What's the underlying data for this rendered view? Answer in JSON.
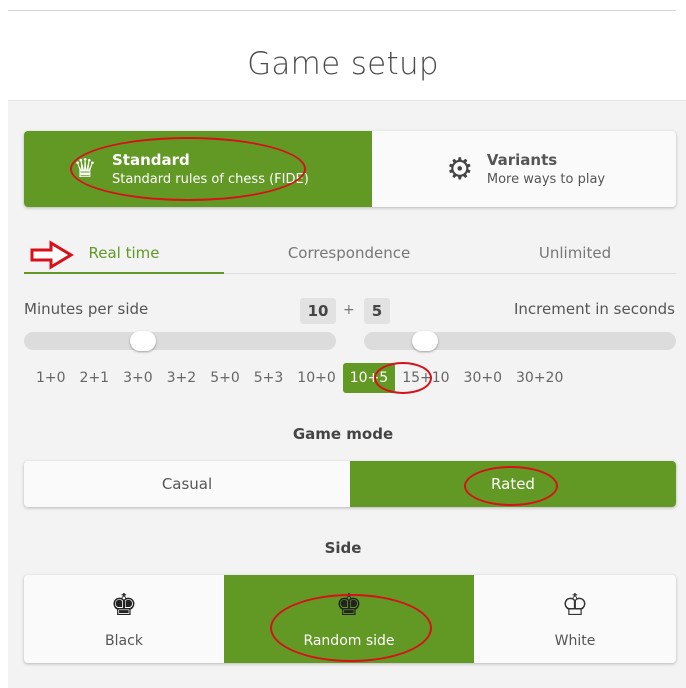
{
  "title": "Game setup",
  "variant_switch": {
    "standard": {
      "name": "Standard",
      "desc": "Standard rules of chess (FIDE)",
      "icon": "crown-icon",
      "selected": true
    },
    "variants": {
      "name": "Variants",
      "desc": "More ways to play",
      "icon": "gears-icon",
      "selected": false
    }
  },
  "time_tabs": [
    {
      "label": "Real time",
      "active": true
    },
    {
      "label": "Correspondence",
      "active": false
    },
    {
      "label": "Unlimited",
      "active": false
    }
  ],
  "time": {
    "minutes_label": "Minutes per side",
    "increment_label": "Increment in seconds",
    "minutes": "10",
    "increment": "5",
    "plus": "+"
  },
  "presets": [
    "1+0",
    "2+1",
    "3+0",
    "3+2",
    "5+0",
    "5+3",
    "10+0",
    "10+5",
    "15+10",
    "30+0",
    "30+20"
  ],
  "selected_preset": "10+5",
  "game_mode": {
    "label": "Game mode",
    "casual": "Casual",
    "rated": "Rated",
    "selected": "Rated"
  },
  "side": {
    "label": "Side",
    "black": "Black",
    "random": "Random side",
    "white": "White",
    "selected": "Random side"
  },
  "colors": {
    "accent": "#629924",
    "annotation": "#d8101a"
  }
}
